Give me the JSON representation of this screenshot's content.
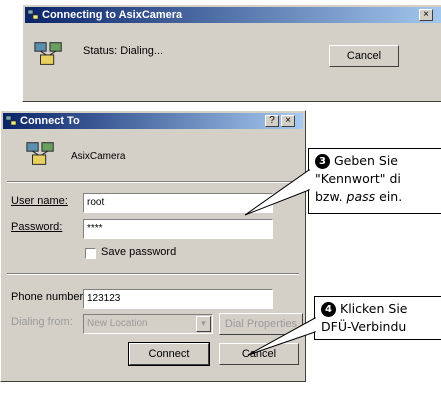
{
  "connecting_dialog": {
    "title": "Connecting to AsixCamera",
    "close_glyph": "×",
    "status": "Status: Dialing...",
    "cancel_label": "Cancel"
  },
  "connect_dialog": {
    "title": "Connect To",
    "help_glyph": "?",
    "close_glyph": "×",
    "connection_name": "AsixCamera",
    "username_label": "User name:",
    "username_value": "root",
    "password_label": "Password:",
    "password_value": "****",
    "save_password_label": "Save password",
    "phone_label": "Phone number:",
    "phone_value": "123123",
    "dialing_from_label": "Dialing from:",
    "dialing_from_value": "New Location",
    "dial_properties_label": "Dial Properties",
    "connect_label": "Connect",
    "cancel_label": "Cancel"
  },
  "callouts": {
    "step3": {
      "number": "❸",
      "line1": "Geben Sie",
      "line2": "\"Kennwort\" di",
      "line3_prefix": "bzw. ",
      "line3_italic": "pass",
      "line3_suffix": " ein."
    },
    "step4": {
      "number": "❹",
      "line1": "Klicken Sie",
      "line2": "DFÜ-Verbindu"
    }
  },
  "colors": {
    "titlebar_start": "#0a246a",
    "titlebar_end": "#a6caf0",
    "dialog_face": "#d4d0c8"
  }
}
